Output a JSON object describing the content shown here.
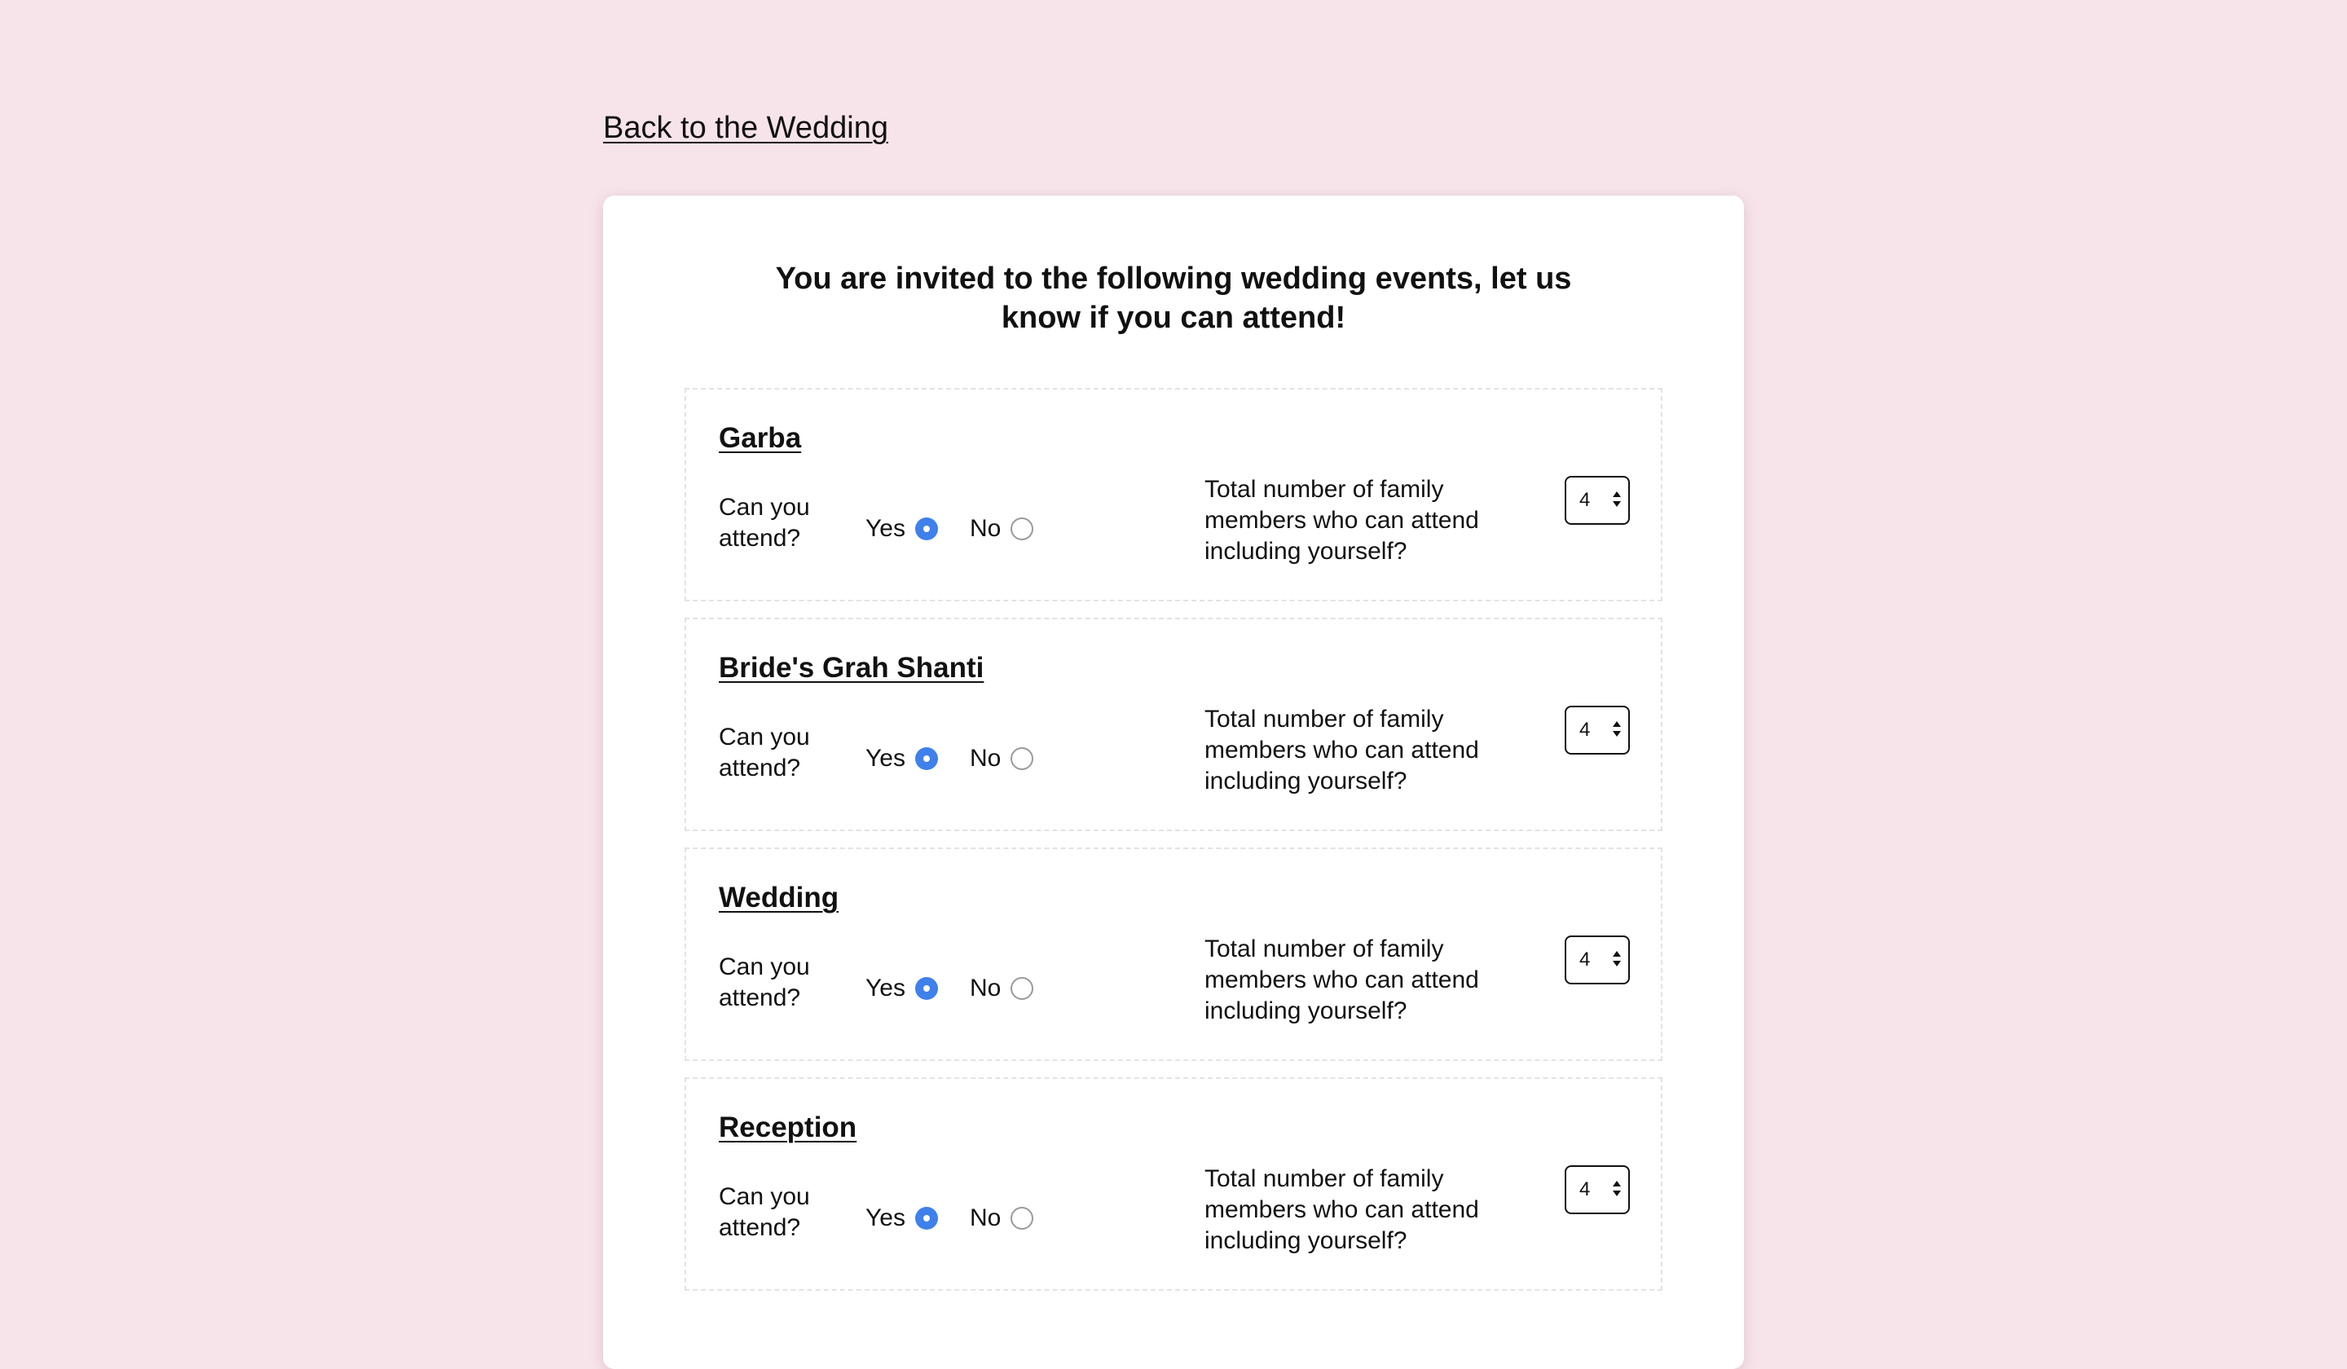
{
  "nav": {
    "back_label": "Back to the Wedding"
  },
  "form": {
    "heading": "You are invited to the following wedding events, let us know if you can attend!",
    "attend_question": "Can you attend?",
    "yes_label": "Yes",
    "no_label": "No",
    "count_question": "Total number of family members who can attend including yourself?",
    "events": [
      {
        "title": "Garba",
        "attending": "Yes",
        "count": "4"
      },
      {
        "title": "Bride's Grah Shanti",
        "attending": "Yes",
        "count": "4"
      },
      {
        "title": "Wedding",
        "attending": "Yes",
        "count": "4"
      },
      {
        "title": "Reception",
        "attending": "Yes",
        "count": "4"
      }
    ]
  },
  "colors": {
    "background": "#f7e4ea",
    "card": "#ffffff",
    "radio_selected": "#3f80ea"
  }
}
